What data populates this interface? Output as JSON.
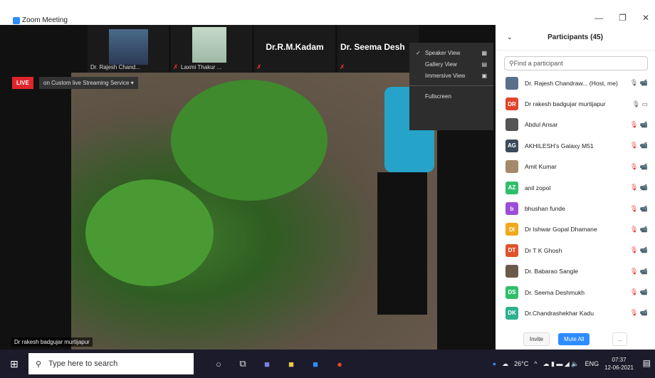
{
  "window": {
    "title": "Zoom Meeting",
    "minimize": "—",
    "restore": "❐",
    "close": "✕"
  },
  "thumbnails": [
    {
      "name": "Dr. Rajesh Chand...",
      "type": "video"
    },
    {
      "name": "Laxmi Thakur ...",
      "type": "video"
    },
    {
      "name": "Dr.R.M.Kadam",
      "type": "name"
    },
    {
      "name": "Dr. Seema Desh",
      "type": "name"
    }
  ],
  "live": {
    "badge": "LIVE",
    "stream_text": "on Custom live Streaming Service ▾"
  },
  "speaker_label": "Dr rakesh badgujar murtijapur",
  "view_menu": {
    "items": [
      {
        "label": "Speaker View",
        "checked": true,
        "icon": "▦"
      },
      {
        "label": "Gallery View",
        "checked": false,
        "icon": "▤"
      },
      {
        "label": "Immersive View",
        "checked": false,
        "icon": "▣"
      }
    ],
    "fullscreen": "Fullscreen"
  },
  "participants": {
    "title": "Participants (45)",
    "search_placeholder": "Find a participant",
    "list": [
      {
        "name": "Dr. Rajesh Chandraw... (Host, me)",
        "initials": "",
        "color": "#5a6f8a",
        "icons": "🎙 📹",
        "muted": false
      },
      {
        "name": "Dr rakesh badgujar murtijapur",
        "initials": "DR",
        "color": "#e0452b",
        "icons": "🎙 ▭",
        "muted": false
      },
      {
        "name": "Abdul Ansar",
        "initials": "",
        "color": "#555555",
        "icons": "🎙 📹",
        "muted": true
      },
      {
        "name": "AKHILESH's Galaxy M51",
        "initials": "AG",
        "color": "#3a4a5a",
        "icons": "🎙 📹",
        "muted": true
      },
      {
        "name": "Amit Kumar",
        "initials": "",
        "color": "#a58a6a",
        "icons": "🎙 📹",
        "muted": true
      },
      {
        "name": "anil zopol",
        "initials": "AZ",
        "color": "#2fbf6a",
        "icons": "🎙 📹",
        "muted": true
      },
      {
        "name": "bhushan funde",
        "initials": "b",
        "color": "#9b4fd6",
        "icons": "🎙 📹",
        "muted": true
      },
      {
        "name": "Dr Ishwar Gopal Dhamane",
        "initials": "DI",
        "color": "#f2a81d",
        "icons": "🎙 📹",
        "muted": true
      },
      {
        "name": "Dr T K Ghosh",
        "initials": "DT",
        "color": "#e0542b",
        "icons": "🎙 📹",
        "muted": true
      },
      {
        "name": "Dr. Babarao Sangle",
        "initials": "",
        "color": "#6a5a4a",
        "icons": "🎙 📹",
        "muted": true
      },
      {
        "name": "Dr. Seema Deshmukh",
        "initials": "DS",
        "color": "#2fbf6a",
        "icons": "🎙 📹",
        "muted": true
      },
      {
        "name": "Dr.Chandrashekhar Kadu",
        "initials": "DK",
        "color": "#2fb08f",
        "icons": "🎙 📹",
        "muted": true
      }
    ],
    "invite": "Invite",
    "mute_all": "Mute All",
    "more": "..."
  },
  "taskbar": {
    "search_text": "Type here to search",
    "weather": "26°C",
    "lang": "ENG",
    "time": "07:37",
    "date": "12-06-2021"
  }
}
